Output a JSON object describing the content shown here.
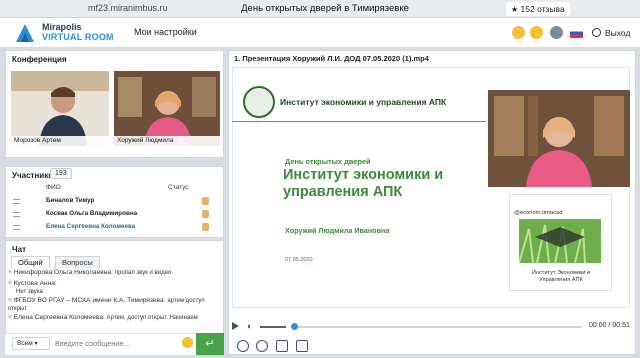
{
  "browser": {
    "url": "mf23.miranimbus.ru",
    "title": "День открытых дверей в Тимирязевке",
    "rating": "152 отзыва",
    "icons": [
      "back-icon",
      "menu-icon",
      "yandex-icon",
      "lock-icon",
      "bookmark-icon",
      "download-icon",
      "minimize-icon"
    ]
  },
  "app": {
    "logo_line1": "Mirapolis",
    "logo_line2": "VIRTUAL ROOM",
    "settings_label": "Мои настройки",
    "exit_label": "Выход",
    "header_icons": [
      "hand-icon",
      "smile-icon",
      "user-circle-icon",
      "flag-ru-icon"
    ],
    "colors": {
      "accent": "#2d8fd5",
      "send": "#4aa34b",
      "slide_green": "#3b8a3b"
    }
  },
  "conference": {
    "title": "Конференция",
    "participants": [
      {
        "name": "Морозов Артем"
      },
      {
        "name": "Хоружий Людмила"
      }
    ]
  },
  "participants": {
    "title": "Участники",
    "count": "193",
    "columns": [
      "ФИО",
      "Статус"
    ],
    "rows": [
      {
        "name": "Биналов Тимур"
      },
      {
        "name": "Косвак Ольга Владимировна"
      },
      {
        "name": "Елена Сергеевна Коломеева"
      }
    ]
  },
  "chat": {
    "title": "Чат",
    "tabs": [
      "Общий",
      "Вопросы"
    ],
    "messages": [
      {
        "author": "Никифорова Ольга  Николаевна:",
        "text": "пропал звук и видео"
      },
      {
        "author": "Кустова  Анна:",
        "text": "Нет звука"
      },
      {
        "author": "ФГБОУ ВО РГАУ – МСХА имени К.А. Тимирязева:",
        "text": "артем доступ открыт"
      },
      {
        "author": "Елена Сергеевна Коломеева:",
        "text": "Артем, доступ открыт. Начинаем"
      }
    ],
    "recipient": "Всем",
    "input_placeholder": "Введите сообщение..."
  },
  "presentation": {
    "title": "1. Презентация Хоружий Л.И. ДОД 07.05.2020 (1).mp4",
    "slide_header": "Институт экономики и управления АПК",
    "slide_subtitle": "День открытых дверей",
    "slide_main": "Институт экономики и управления АПК",
    "slide_author": "Хоружий Людмила Ивановна",
    "slide_date": "07.05.2020",
    "card_handle": "@econom.timacad",
    "card_name": "Институт Экономики и Управления АПК",
    "time": "00:00 / 00:51",
    "progress": 0
  }
}
